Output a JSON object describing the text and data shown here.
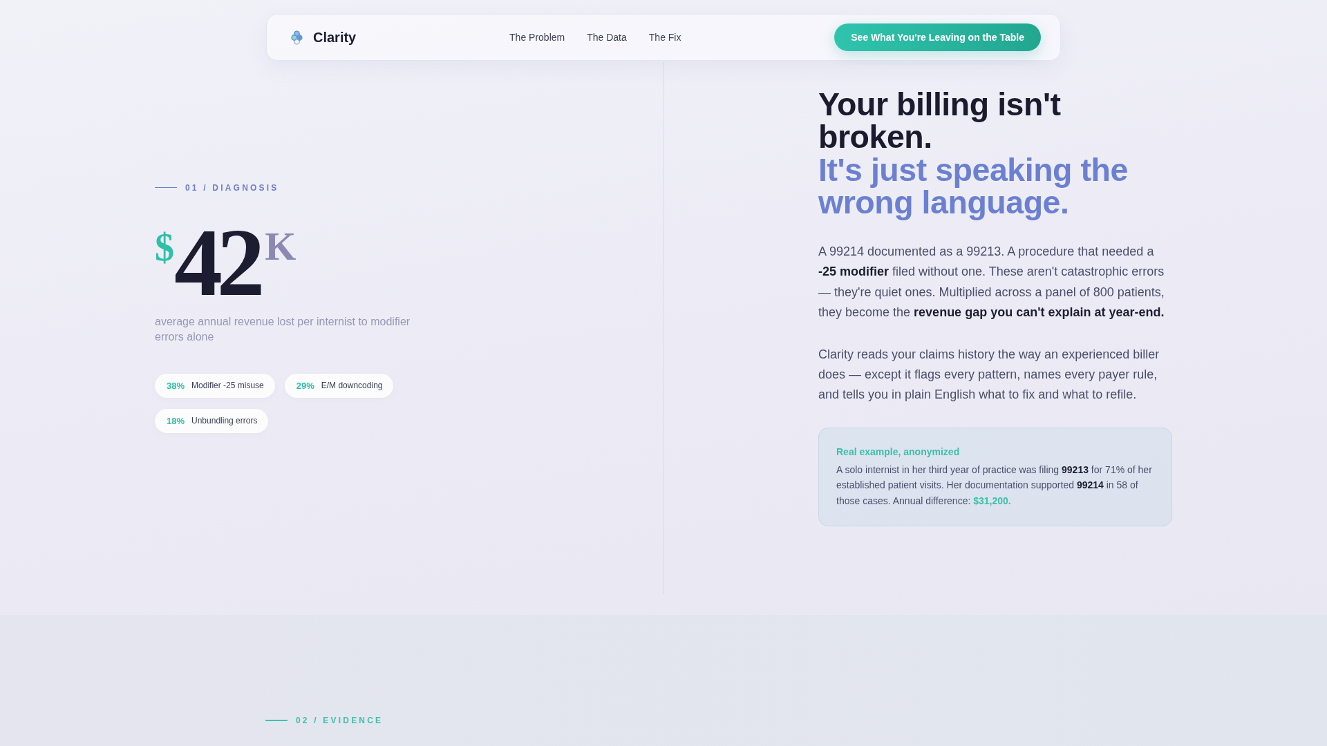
{
  "nav": {
    "brand": "Clarity",
    "links": [
      {
        "label": "The Problem"
      },
      {
        "label": "The Data"
      },
      {
        "label": "The Fix"
      }
    ],
    "cta": "See What You're Leaving on the Table"
  },
  "diagnosis": {
    "section_label": "01 / DIAGNOSIS",
    "stat": {
      "currency": "$",
      "amount": "42",
      "unit": "K"
    },
    "caption": "average annual revenue lost per internist to modifier errors alone",
    "chips": [
      {
        "percent": "38%",
        "label": "Modifier -25 misuse"
      },
      {
        "percent": "29%",
        "label": "E/M downcoding"
      },
      {
        "percent": "18%",
        "label": "Unbundling errors"
      }
    ]
  },
  "intro": {
    "heading": "Your billing isn't broken.",
    "heading_accent": "It's just speaking the wrong language.",
    "paragraphs": [
      "A 99214 documented as a 99213. A procedure that needed a **-25 modifier** filed without one. These aren't catastrophic errors — they're quiet ones. Multiplied across a panel of 800 patients, they become the **revenue gap you can't explain at year-end.**",
      "Clarity reads your claims history the way an experienced biller does — except it flags every pattern, names every payer rule, and tells you in plain English what to fix and what to refile."
    ],
    "example": {
      "title": "Real example, anonymized",
      "text": "A solo internist in her third year of practice was filing **99213** for 71% of her established patient visits. Her documentation supported **99214** in 58 of those cases. Annual difference:",
      "result": "$31,200."
    }
  },
  "evidence": {
    "section_label": "02 / EVIDENCE"
  }
}
